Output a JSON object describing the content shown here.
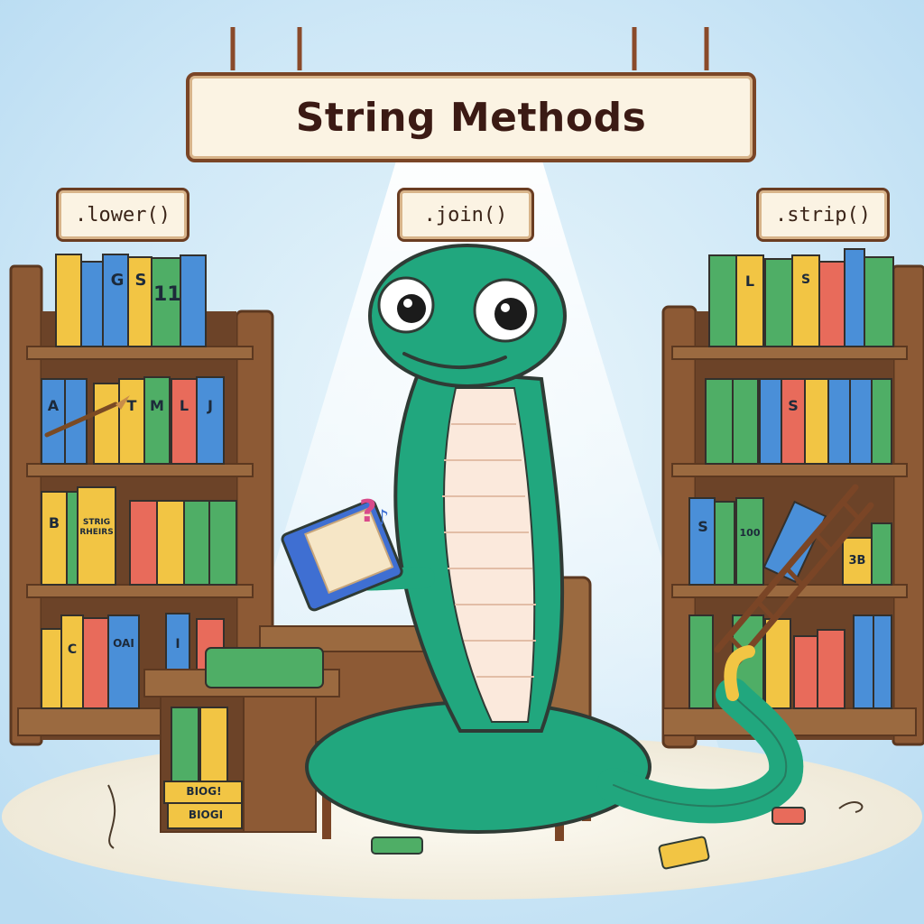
{
  "title": "String Methods",
  "method_signs": [
    ".lower()",
    ".join()",
    ".strip()"
  ],
  "book_spine_labels": {
    "left_top": [
      "G",
      "S",
      "11"
    ],
    "left_middle": [
      "A",
      "T",
      "M",
      "L",
      "J"
    ],
    "left_lower": [
      "B",
      "STRIG RHEIRS"
    ],
    "left_bottom": [
      "C",
      "OAI",
      "I"
    ],
    "right_top": [
      "L",
      "S"
    ],
    "right_middle": [
      "S"
    ],
    "right_lower": [
      "S",
      "100",
      "3B"
    ],
    "desk_stack": [
      "BIOG!",
      "BIOGI"
    ]
  },
  "colors": {
    "sky": "#cfe7f6",
    "snake": "#21a77e",
    "shelf_wood": "#8d5a35",
    "sign_paper": "#fbf3e3"
  },
  "icons": [
    "question-mark",
    "music-note",
    "quill-pen",
    "ladder",
    "book"
  ]
}
